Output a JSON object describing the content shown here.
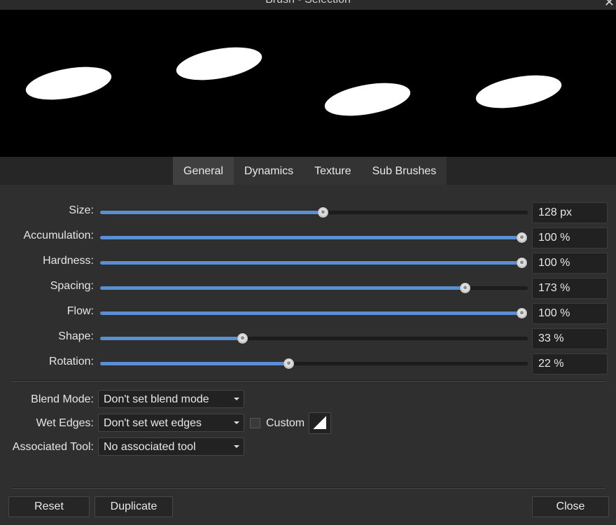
{
  "window": {
    "title": "Brush - Selection",
    "close_glyph": "✕"
  },
  "tabs": [
    {
      "label": "General",
      "active": true
    },
    {
      "label": "Dynamics",
      "active": false
    },
    {
      "label": "Texture",
      "active": false
    },
    {
      "label": "Sub Brushes",
      "active": false
    }
  ],
  "sliders": [
    {
      "label": "Size:",
      "value": "128 px",
      "fraction": 0.52
    },
    {
      "label": "Accumulation:",
      "value": "100 %",
      "fraction": 0.985
    },
    {
      "label": "Hardness:",
      "value": "100 %",
      "fraction": 0.985
    },
    {
      "label": "Spacing:",
      "value": "173 %",
      "fraction": 0.853
    },
    {
      "label": "Flow:",
      "value": "100 %",
      "fraction": 0.985
    },
    {
      "label": "Shape:",
      "value": "33 %",
      "fraction": 0.333
    },
    {
      "label": "Rotation:",
      "value": "22 %",
      "fraction": 0.441
    }
  ],
  "blend_mode": {
    "label": "Blend Mode:",
    "value": "Don't set blend mode"
  },
  "wet_edges": {
    "label": "Wet Edges:",
    "value": "Don't set wet edges",
    "custom_label": "Custom",
    "custom_checked": false
  },
  "associated_tool": {
    "label": "Associated Tool:",
    "value": "No associated tool"
  },
  "buttons": {
    "reset": "Reset",
    "duplicate": "Duplicate",
    "close": "Close"
  },
  "colors": {
    "accent": "#5b8fd4",
    "panel": "#2f2f2f",
    "preview_bg": "#000000"
  }
}
